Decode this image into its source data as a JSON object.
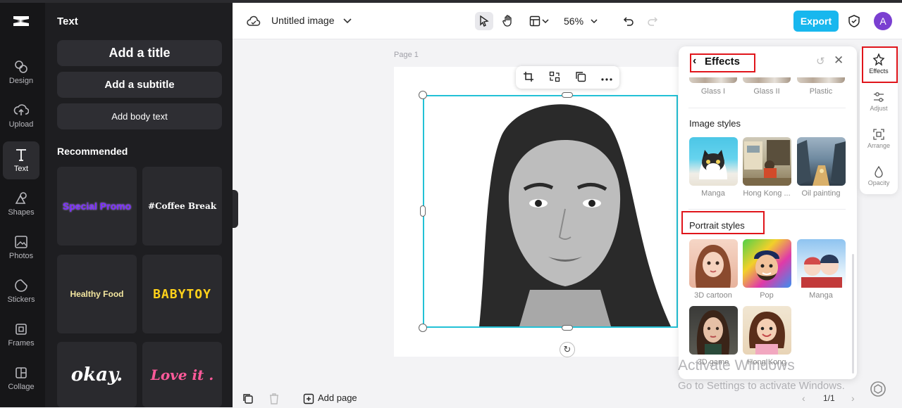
{
  "left_rail": {
    "items": [
      {
        "label": "Design",
        "icon": "design-icon"
      },
      {
        "label": "Upload",
        "icon": "upload-icon"
      },
      {
        "label": "Text",
        "icon": "text-icon"
      },
      {
        "label": "Shapes",
        "icon": "shapes-icon"
      },
      {
        "label": "Photos",
        "icon": "photos-icon"
      },
      {
        "label": "Stickers",
        "icon": "stickers-icon"
      },
      {
        "label": "Frames",
        "icon": "frames-icon"
      },
      {
        "label": "Collage",
        "icon": "collage-icon"
      }
    ],
    "active": "Text"
  },
  "text_panel": {
    "title": "Text",
    "add_title": "Add a title",
    "add_subtitle": "Add a subtitle",
    "add_body": "Add body text",
    "recommended_title": "Recommended",
    "tiles": [
      "Special Promo",
      "#Coffee Break",
      "Healthy Food",
      "BABYTOY",
      "okay.",
      "Love it ."
    ]
  },
  "topbar": {
    "doc_title": "Untitled image",
    "zoom": "56%",
    "export_label": "Export",
    "avatar_letter": "A",
    "accent": "#18b7ee"
  },
  "canvas": {
    "page_label": "Page 1"
  },
  "effects": {
    "title": "Effects",
    "prev_row": [
      "Glass I",
      "Glass II",
      "Plastic"
    ],
    "image_styles_title": "Image styles",
    "image_styles": [
      "Manga",
      "Hong Kong ...",
      "Oil painting"
    ],
    "portrait_styles_title": "Portrait styles",
    "portrait_styles": [
      "3D cartoon",
      "Pop",
      "Manga",
      "3D game",
      "Hong Kong"
    ]
  },
  "right_rail": {
    "items": [
      "Effects",
      "Adjust",
      "Arrange",
      "Opacity"
    ]
  },
  "bottombar": {
    "add_page": "Add page",
    "pager": "1/1"
  },
  "watermark": {
    "line1": "Activate Windows",
    "line2": "Go to Settings to activate Windows."
  }
}
